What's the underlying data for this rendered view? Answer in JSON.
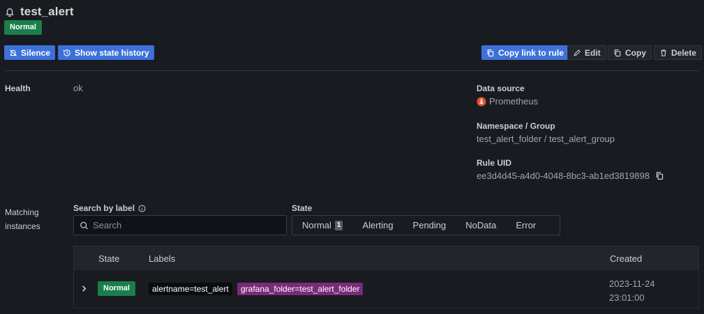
{
  "header": {
    "title": "test_alert",
    "state_badge": "Normal"
  },
  "actions": {
    "silence": "Silence",
    "state_history": "Show state history",
    "copy_link": "Copy link to rule",
    "edit": "Edit",
    "copy": "Copy",
    "delete": "Delete"
  },
  "details": {
    "health_label": "Health",
    "health_value": "ok",
    "datasource_label": "Data source",
    "datasource_value": "Prometheus",
    "namespace_label": "Namespace / Group",
    "namespace_value": "test_alert_folder / test_alert_group",
    "uid_label": "Rule UID",
    "uid_value": "ee3d4d45-a4d0-4048-8bc3-ab1ed3819898"
  },
  "instances": {
    "section_label_1": "Matching",
    "section_label_2": "instances",
    "search_label": "Search by label",
    "search_placeholder": "Search",
    "state_label": "State",
    "state_options": [
      {
        "label": "Normal",
        "count": "1"
      },
      {
        "label": "Alerting"
      },
      {
        "label": "Pending"
      },
      {
        "label": "NoData"
      },
      {
        "label": "Error"
      }
    ],
    "columns": {
      "state": "State",
      "labels": "Labels",
      "created": "Created"
    },
    "rows": [
      {
        "state": "Normal",
        "label1": "alertname=test_alert",
        "label2": "grafana_folder=test_alert_folder",
        "created_date": "2023-11-24",
        "created_time": "23:01:00"
      }
    ]
  },
  "colors": {
    "background": "#181b1f",
    "primary": "#3d71d9",
    "normal": "#1a7f4b",
    "label_purple": "#7b2b79",
    "prometheus": "#e6522c"
  }
}
